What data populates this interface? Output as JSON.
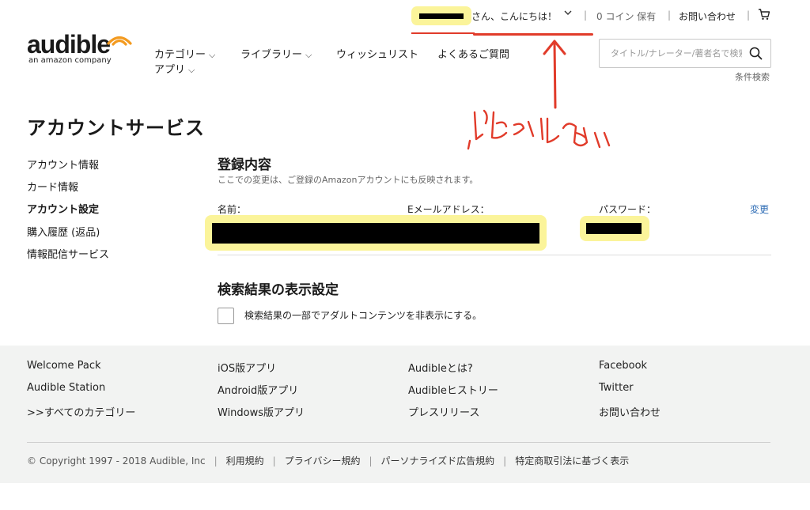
{
  "header": {
    "greeting": "さん、こんにちは！",
    "coins": "0 コイン 保有",
    "contact": "お問い合わせ",
    "logo_word": "audible",
    "logo_sub": "an amazon company"
  },
  "nav": {
    "items": [
      "カテゴリー",
      "ライブラリー",
      "ウィッシュリスト",
      "よくあるご質問",
      "アプリ"
    ]
  },
  "search": {
    "placeholder": "タイトル/ナレーター/著者名で検索",
    "advanced": "条件検索"
  },
  "annotation": {
    "color": "#e13b2a",
    "highlight_color": "#fbf49a"
  },
  "page": {
    "title": "アカウントサービス"
  },
  "sidebar": {
    "items": [
      "アカウント情報",
      "カード情報",
      "アカウント設定",
      "購入履歴 (返品)",
      "情報配信サービス"
    ],
    "active_index": 2
  },
  "registration": {
    "title": "登録内容",
    "note": "ここでの変更は、ご登録のAmazonアカウントにも反映されます。",
    "name_label": "名前：",
    "email_label": "Eメールアドレス：",
    "password_label": "パスワード：",
    "change_link": "変更"
  },
  "search_settings": {
    "title": "検索結果の表示設定",
    "checkbox_label": "検索結果の一部でアダルトコンテンツを非表示にする。",
    "checked": false
  },
  "footer": {
    "columns": [
      [
        "Welcome Pack",
        "Audible Station",
        ">>すべてのカテゴリー"
      ],
      [
        "iOS版アプリ",
        "Android版アプリ",
        "Windows版アプリ"
      ],
      [
        "Audibleとは?",
        "Audibleヒストリー",
        "プレスリリース"
      ],
      [
        "Facebook",
        "Twitter",
        "お問い合わせ"
      ]
    ],
    "copyright": "© Copyright 1997 - 2018 Audible, Inc",
    "legal": [
      "利用規約",
      "プライバシー規約",
      "パーソナライズド広告規約",
      "特定商取引法に基づく表示"
    ]
  }
}
